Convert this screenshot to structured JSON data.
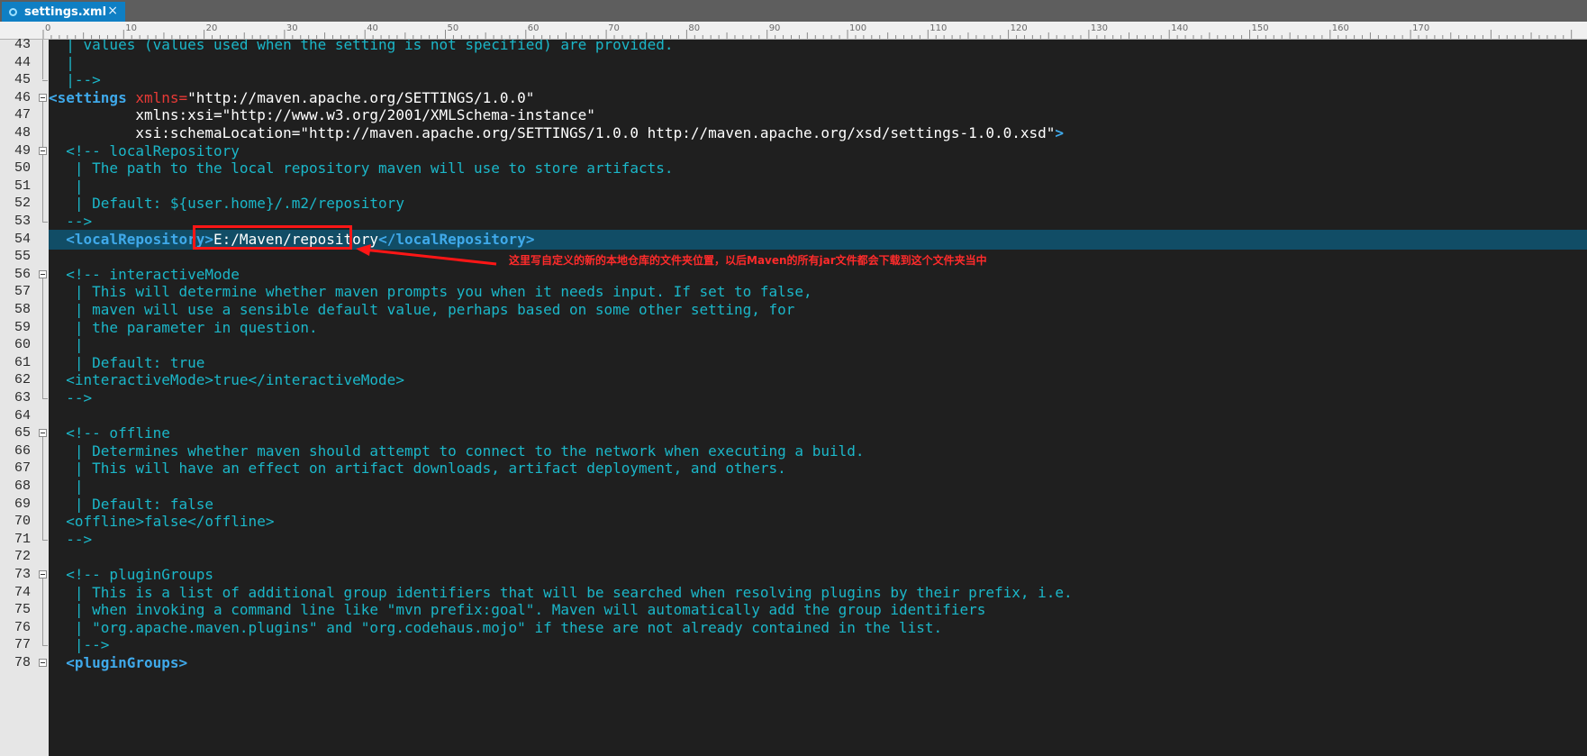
{
  "tab": {
    "title": "settings.xml",
    "icon": "xml-file-icon",
    "close": "×"
  },
  "ruler": {
    "labels": [
      "0",
      "10",
      "20",
      "30",
      "40",
      "50",
      "60",
      "70",
      "80",
      "90",
      "100",
      "110",
      "120",
      "130",
      "140",
      "150",
      "160",
      "170"
    ]
  },
  "lines": [
    {
      "n": "43",
      "segs": [
        [
          "c",
          "  | values (values used when the setting is not specified) are provided."
        ]
      ]
    },
    {
      "n": "44",
      "segs": [
        [
          "c",
          "  |"
        ]
      ]
    },
    {
      "n": "45",
      "segs": [
        [
          "c",
          "  |-->"
        ]
      ]
    },
    {
      "n": "46",
      "segs": [
        [
          "t",
          "<settings "
        ],
        [
          "a",
          "xmlns="
        ],
        [
          "v",
          "\"http://maven.apache.org/SETTINGS/1.0.0\""
        ]
      ]
    },
    {
      "n": "47",
      "segs": [
        [
          "v",
          "          xmlns:xsi=\"http://www.w3.org/2001/XMLSchema-instance\""
        ]
      ]
    },
    {
      "n": "48",
      "segs": [
        [
          "v",
          "          xsi:schemaLocation=\"http://maven.apache.org/SETTINGS/1.0.0 http://maven.apache.org/xsd/settings-1.0.0.xsd\""
        ],
        [
          "t",
          ">"
        ]
      ]
    },
    {
      "n": "49",
      "segs": [
        [
          "c",
          "  <!-- localRepository"
        ]
      ]
    },
    {
      "n": "50",
      "segs": [
        [
          "c",
          "   | The path to the local repository maven will use to store artifacts."
        ]
      ]
    },
    {
      "n": "51",
      "segs": [
        [
          "c",
          "   |"
        ]
      ]
    },
    {
      "n": "52",
      "segs": [
        [
          "c",
          "   | Default: ${user.home}/.m2/repository"
        ]
      ]
    },
    {
      "n": "53",
      "segs": [
        [
          "c",
          "  -->"
        ]
      ]
    },
    {
      "n": "54",
      "segs": [
        [
          "t",
          "  <localRepository>"
        ],
        [
          "v",
          "E:/Maven/repository"
        ],
        [
          "t",
          "</localRepository>"
        ]
      ]
    },
    {
      "n": "55",
      "segs": [
        [
          "c",
          ""
        ]
      ]
    },
    {
      "n": "56",
      "segs": [
        [
          "c",
          "  <!-- interactiveMode"
        ]
      ]
    },
    {
      "n": "57",
      "segs": [
        [
          "c",
          "   | This will determine whether maven prompts you when it needs input. If set to false,"
        ]
      ]
    },
    {
      "n": "58",
      "segs": [
        [
          "c",
          "   | maven will use a sensible default value, perhaps based on some other setting, for"
        ]
      ]
    },
    {
      "n": "59",
      "segs": [
        [
          "c",
          "   | the parameter in question."
        ]
      ]
    },
    {
      "n": "60",
      "segs": [
        [
          "c",
          "   |"
        ]
      ]
    },
    {
      "n": "61",
      "segs": [
        [
          "c",
          "   | Default: true"
        ]
      ]
    },
    {
      "n": "62",
      "segs": [
        [
          "c",
          "  <interactiveMode>true</interactiveMode>"
        ]
      ]
    },
    {
      "n": "63",
      "segs": [
        [
          "c",
          "  -->"
        ]
      ]
    },
    {
      "n": "64",
      "segs": [
        [
          "c",
          ""
        ]
      ]
    },
    {
      "n": "65",
      "segs": [
        [
          "c",
          "  <!-- offline"
        ]
      ]
    },
    {
      "n": "66",
      "segs": [
        [
          "c",
          "   | Determines whether maven should attempt to connect to the network when executing a build."
        ]
      ]
    },
    {
      "n": "67",
      "segs": [
        [
          "c",
          "   | This will have an effect on artifact downloads, artifact deployment, and others."
        ]
      ]
    },
    {
      "n": "68",
      "segs": [
        [
          "c",
          "   |"
        ]
      ]
    },
    {
      "n": "69",
      "segs": [
        [
          "c",
          "   | Default: false"
        ]
      ]
    },
    {
      "n": "70",
      "segs": [
        [
          "c",
          "  <offline>false</offline>"
        ]
      ]
    },
    {
      "n": "71",
      "segs": [
        [
          "c",
          "  -->"
        ]
      ]
    },
    {
      "n": "72",
      "segs": [
        [
          "c",
          ""
        ]
      ]
    },
    {
      "n": "73",
      "segs": [
        [
          "c",
          "  <!-- pluginGroups"
        ]
      ]
    },
    {
      "n": "74",
      "segs": [
        [
          "c",
          "   | This is a list of additional group identifiers that will be searched when resolving plugins by their prefix, i.e."
        ]
      ]
    },
    {
      "n": "75",
      "segs": [
        [
          "c",
          "   | when invoking a command line like \"mvn prefix:goal\". Maven will automatically add the group identifiers"
        ]
      ]
    },
    {
      "n": "76",
      "segs": [
        [
          "c",
          "   | \"org.apache.maven.plugins\" and \"org.codehaus.mojo\" if these are not already contained in the list."
        ]
      ]
    },
    {
      "n": "77",
      "segs": [
        [
          "c",
          "   |-->"
        ]
      ]
    },
    {
      "n": "78",
      "segs": [
        [
          "t",
          "  <pluginGroups>"
        ]
      ]
    }
  ],
  "annotation": "这里写自定义的新的本地仓库的文件夹位置，以后Maven的所有jar文件都会下载到这个文件夹当中",
  "colors": {
    "comment": "#1bb7c9",
    "tag": "#3fa9ea",
    "attr": "#e83a36",
    "value": "#ffffff",
    "current_line": "#114d66",
    "annotation": "#ff2b2b"
  }
}
